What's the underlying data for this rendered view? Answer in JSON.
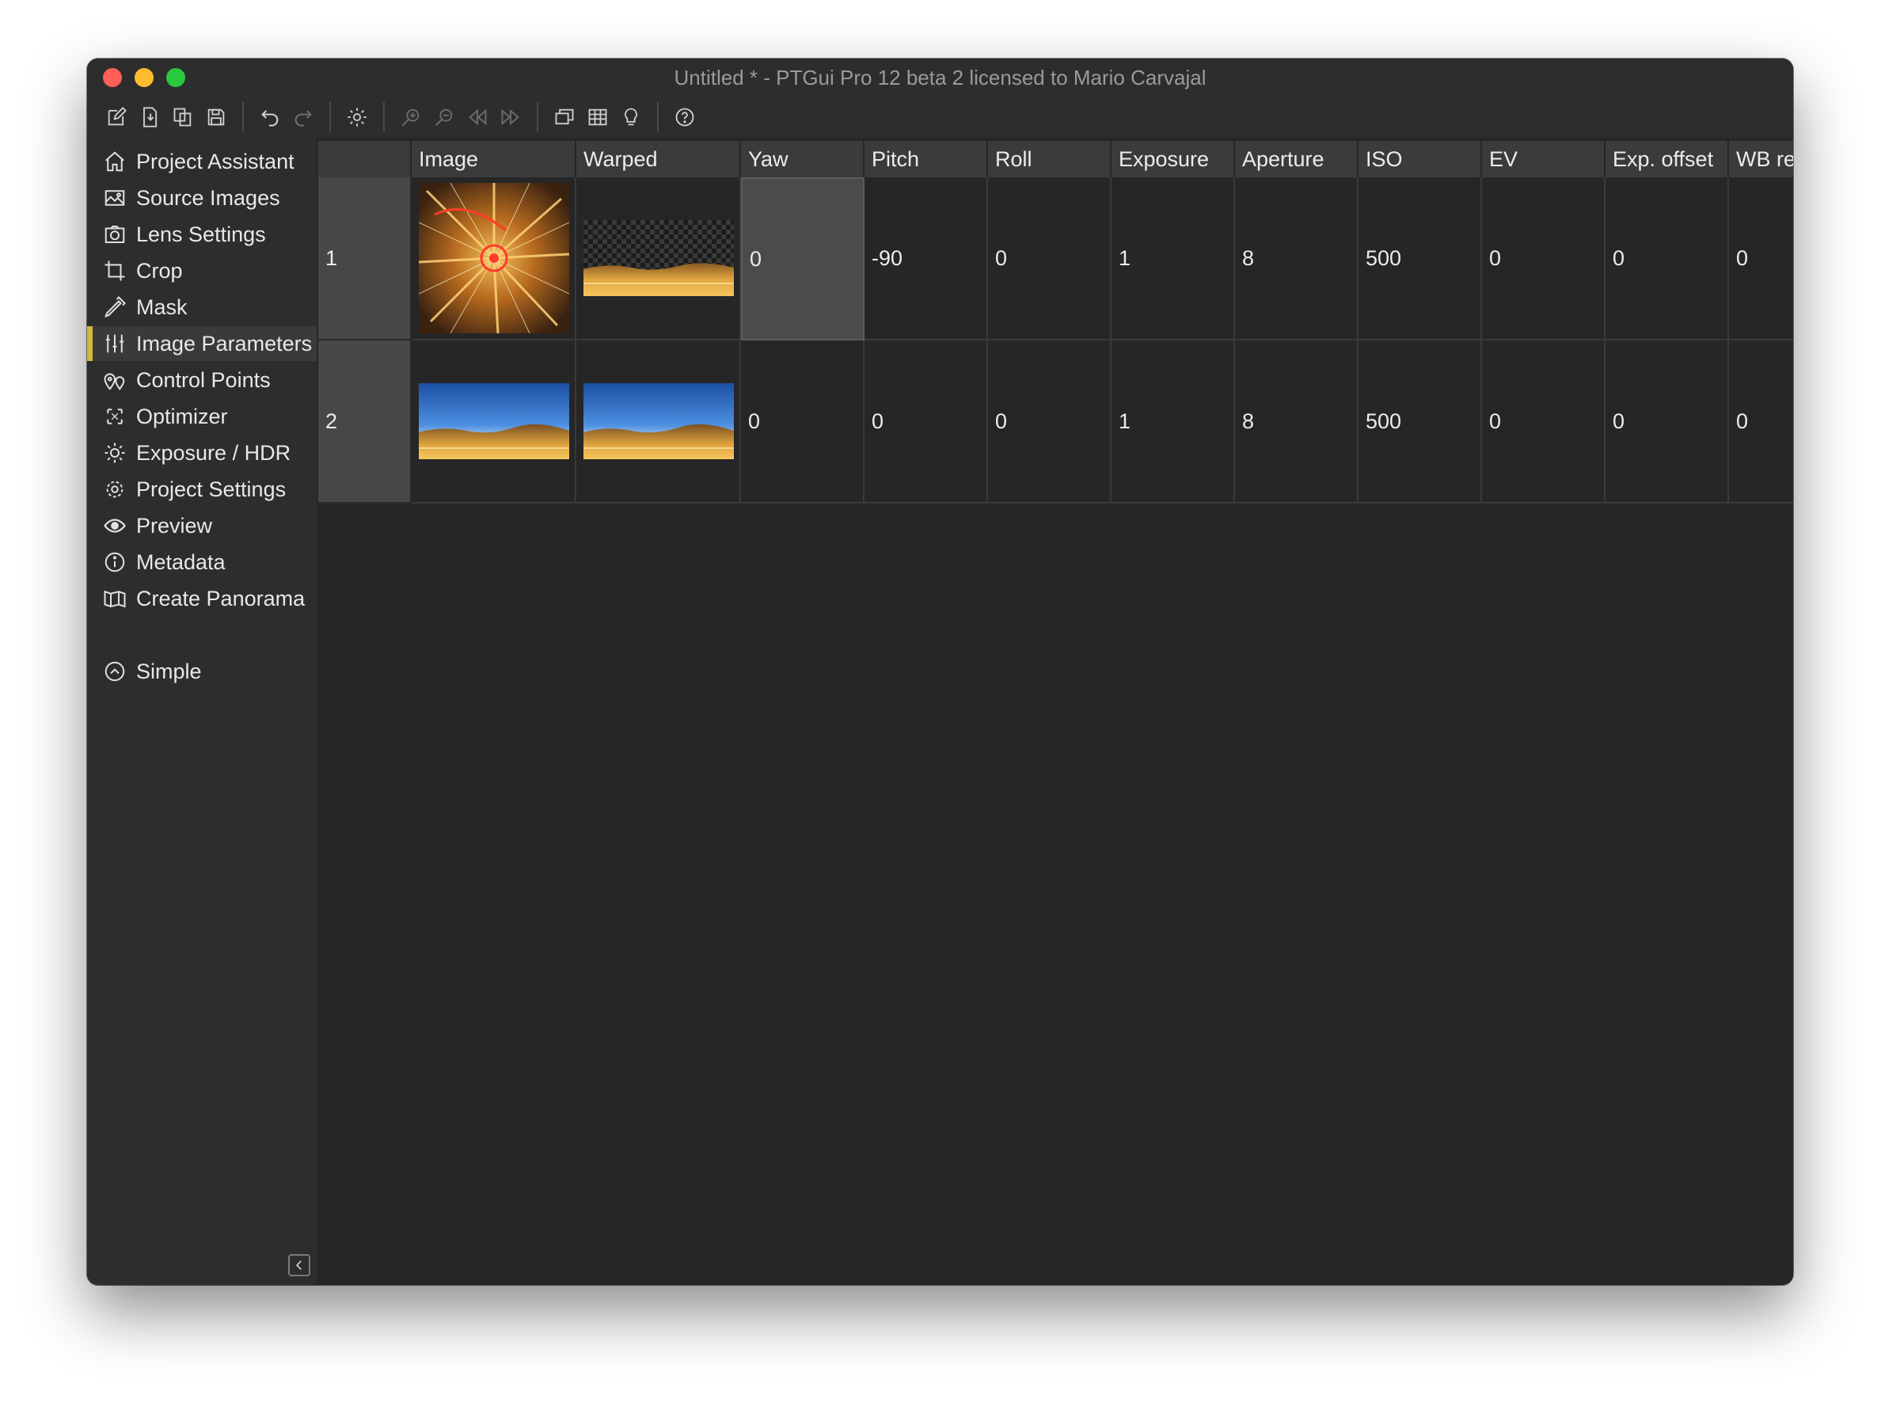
{
  "window": {
    "title": "Untitled * - PTGui Pro 12 beta 2 licensed to Mario Carvajal"
  },
  "toolbar": {
    "buttons": [
      "new-project-icon",
      "open-project-icon",
      "copy-project-icon",
      "save-icon",
      "undo-icon",
      "redo-icon",
      "settings-icon",
      "zoom-in-icon",
      "zoom-out-icon",
      "previous-icon",
      "next-icon",
      "panorama-editor-icon",
      "table-icon",
      "lightbulb-icon",
      "help-icon"
    ]
  },
  "sidebar": {
    "items": [
      {
        "label": "Project Assistant",
        "icon": "home-icon"
      },
      {
        "label": "Source Images",
        "icon": "image-icon"
      },
      {
        "label": "Lens Settings",
        "icon": "camera-icon"
      },
      {
        "label": "Crop",
        "icon": "crop-icon"
      },
      {
        "label": "Mask",
        "icon": "pen-icon"
      },
      {
        "label": "Image Parameters",
        "icon": "sliders-icon",
        "active": true
      },
      {
        "label": "Control Points",
        "icon": "pins-icon"
      },
      {
        "label": "Optimizer",
        "icon": "optimizer-icon"
      },
      {
        "label": "Exposure / HDR",
        "icon": "sun-icon"
      },
      {
        "label": "Project Settings",
        "icon": "gear-icon"
      },
      {
        "label": "Preview",
        "icon": "eye-icon"
      },
      {
        "label": "Metadata",
        "icon": "info-icon"
      },
      {
        "label": "Create Panorama",
        "icon": "map-icon"
      }
    ],
    "simple": {
      "label": "Simple",
      "icon": "chevron-up-circle-icon"
    }
  },
  "table": {
    "columns": [
      "",
      "Image",
      "Warped",
      "Yaw",
      "Pitch",
      "Roll",
      "Exposure",
      "Aperture",
      "ISO",
      "EV",
      "Exp. offset",
      "WB re"
    ],
    "rows": [
      {
        "index": "1",
        "yaw": "0",
        "pitch": "-90",
        "roll": "0",
        "exposure": "1",
        "aperture": "8",
        "iso": "500",
        "ev": "0",
        "exp_offset": "0",
        "wb": "0"
      },
      {
        "index": "2",
        "yaw": "0",
        "pitch": "0",
        "roll": "0",
        "exposure": "1",
        "aperture": "8",
        "iso": "500",
        "ev": "0",
        "exp_offset": "0",
        "wb": "0"
      }
    ]
  },
  "colors": {
    "accent": "#d6b63b",
    "background": "#262626",
    "sidebar": "#2d2d2d",
    "header": "#3b3b3b"
  }
}
